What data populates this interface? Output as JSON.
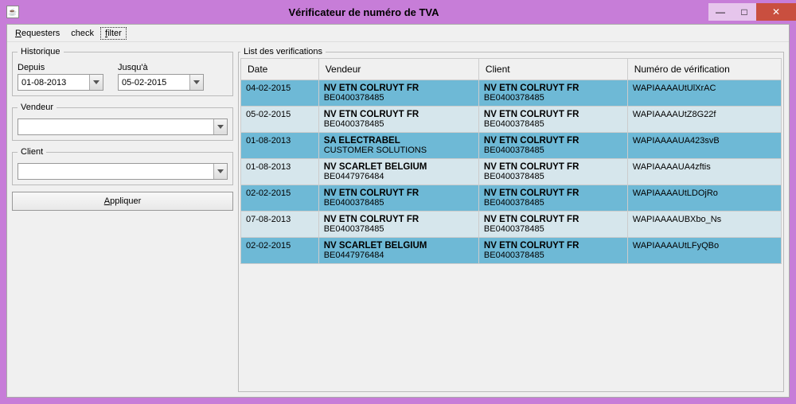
{
  "window": {
    "title": "Vérificateur de numéro de TVA"
  },
  "menu": {
    "requesters": "Requesters",
    "check": "check",
    "filter": "filter"
  },
  "historique": {
    "legend": "Historique",
    "depuis_label": "Depuis",
    "depuis_value": "01-08-2013",
    "jusqua_label": "Jusqu'à",
    "jusqua_value": "05-02-2015"
  },
  "vendeur": {
    "legend": "Vendeur",
    "value": ""
  },
  "client": {
    "legend": "Client",
    "value": ""
  },
  "apply_label": "Appliquer",
  "list": {
    "legend": "List des verifications",
    "columns": {
      "date": "Date",
      "vendeur": "Vendeur",
      "client": "Client",
      "numero": "Numéro de vérification"
    },
    "rows": [
      {
        "shade": "dark",
        "date": "04-02-2015",
        "vendeur_l1": "NV ETN COLRUYT FR",
        "vendeur_l2": "BE0400378485",
        "client_l1": "NV ETN COLRUYT FR",
        "client_l2": "BE0400378485",
        "numero": "WAPIAAAAUtUlXrAC"
      },
      {
        "shade": "light",
        "date": "05-02-2015",
        "vendeur_l1": "NV ETN COLRUYT FR",
        "vendeur_l2": "BE0400378485",
        "client_l1": "NV ETN COLRUYT FR",
        "client_l2": "BE0400378485",
        "numero": "WAPIAAAAUtZ8G22f"
      },
      {
        "shade": "dark",
        "date": "01-08-2013",
        "vendeur_l1": "SA ELECTRABEL",
        "vendeur_l2": "CUSTOMER SOLUTIONS",
        "client_l1": "NV ETN COLRUYT FR",
        "client_l2": "BE0400378485",
        "numero": "WAPIAAAAUA423svB"
      },
      {
        "shade": "light",
        "date": "01-08-2013",
        "vendeur_l1": "NV SCARLET BELGIUM",
        "vendeur_l2": "BE0447976484",
        "client_l1": "NV ETN COLRUYT FR",
        "client_l2": "BE0400378485",
        "numero": "WAPIAAAAUA4zftis"
      },
      {
        "shade": "dark",
        "date": "02-02-2015",
        "vendeur_l1": "NV ETN COLRUYT FR",
        "vendeur_l2": "BE0400378485",
        "client_l1": "NV ETN COLRUYT FR",
        "client_l2": "BE0400378485",
        "numero": "WAPIAAAAUtLDOjRo"
      },
      {
        "shade": "light",
        "date": "07-08-2013",
        "vendeur_l1": "NV ETN COLRUYT FR",
        "vendeur_l2": "BE0400378485",
        "client_l1": "NV ETN COLRUYT FR",
        "client_l2": "BE0400378485",
        "numero": "WAPIAAAAUBXbo_Ns"
      },
      {
        "shade": "dark",
        "date": "02-02-2015",
        "vendeur_l1": "NV SCARLET BELGIUM",
        "vendeur_l2": "BE0447976484",
        "client_l1": "NV ETN COLRUYT FR",
        "client_l2": "BE0400378485",
        "numero": "WAPIAAAAUtLFyQBo"
      }
    ]
  }
}
